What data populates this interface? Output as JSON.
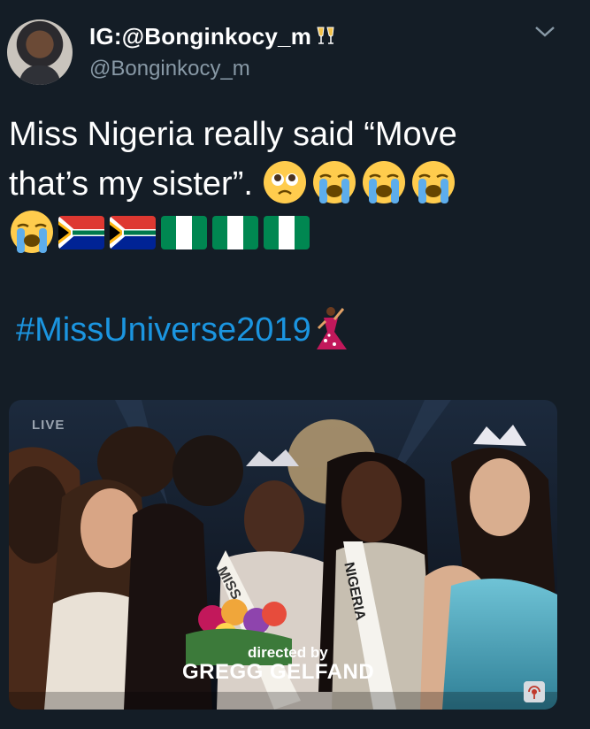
{
  "header": {
    "display_name": "IG:@Bonginkocy_m",
    "display_name_emoji": "clinking-glasses-icon",
    "handle": "@Bonginkocy_m",
    "menu_icon": "chevron-down-icon"
  },
  "tweet": {
    "line1": "Miss Nigeria really said “Move",
    "line2_text": "that’s my sister”.",
    "emojis_line2": [
      "pleading-face-icon",
      "loudly-crying-face-icon",
      "loudly-crying-face-icon",
      "loudly-crying-face-icon"
    ],
    "emojis_line3": [
      "loudly-crying-face-icon",
      "flag-south-africa-icon",
      "flag-south-africa-icon",
      "flag-nigeria-icon",
      "flag-nigeria-icon",
      "flag-nigeria-icon"
    ],
    "hashtag": "#MissUniverse2019",
    "hashtag_emoji": "woman-dancing-icon"
  },
  "media": {
    "live_label": "LIVE",
    "credit_top": "directed by",
    "credit_name": "GREGG GELFAND",
    "sash_left": "MISS",
    "sash_right": "NIGERIA"
  },
  "colors": {
    "background": "#141d26",
    "text": "#ffffff",
    "secondary_text": "#8899a6",
    "link": "#1b95e0"
  }
}
